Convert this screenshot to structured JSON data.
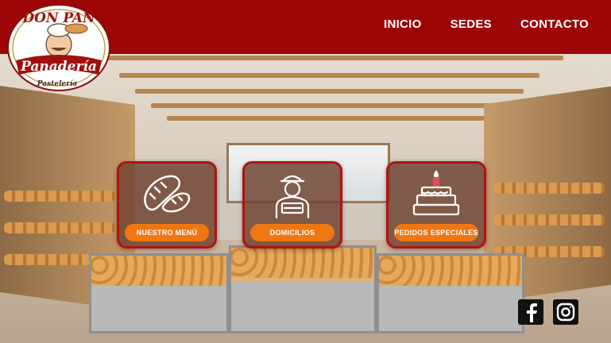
{
  "logo": {
    "line1": "DON PAN",
    "ribbon": "Panadería",
    "sub": "Pastelería"
  },
  "nav": {
    "items": [
      {
        "label": "INICIO"
      },
      {
        "label": "SEDES"
      },
      {
        "label": "CONTACTO"
      }
    ]
  },
  "cards": [
    {
      "label": "NUESTRO MENÚ",
      "icon": "bread-icon"
    },
    {
      "label": "DOMICILIOS",
      "icon": "delivery-person-icon"
    },
    {
      "label": "PEDIDOS ESPECIALES",
      "icon": "cake-icon"
    }
  ],
  "social": [
    {
      "icon": "facebook-icon"
    },
    {
      "icon": "instagram-icon"
    }
  ],
  "colors": {
    "header": "#9c0606",
    "button": "#ef7712",
    "card_border": "#b31212"
  }
}
